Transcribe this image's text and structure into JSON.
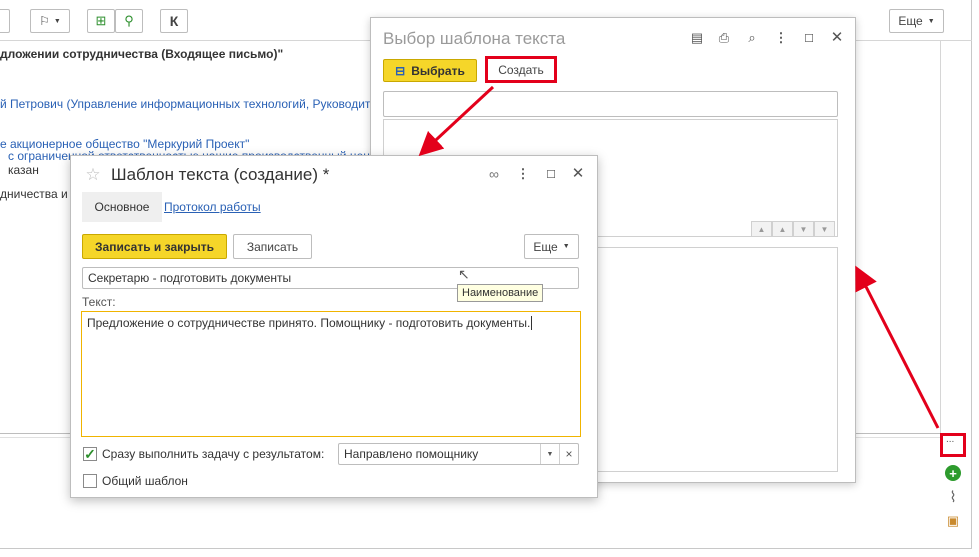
{
  "toolbar": {
    "more_label": "Еще",
    "k_label": "К"
  },
  "document": {
    "title_fragment": "дложении сотрудничества (Входящее письмо)\"",
    "author_fragment": "й Петрович (Управление информационных технологий, Руководите",
    "org_line1": "е акционерное общество \"Меркурий Проект\"",
    "org_line2": "с ограниченной ответственностью нашие производственный цент",
    "refused_fragment": "казан",
    "coop_fragment": "дничества и у"
  },
  "select_window": {
    "title": "Выбор шаблона текста",
    "select_label": "Выбрать",
    "create_label": "Создать"
  },
  "create_window": {
    "title": "Шаблон текста (создание) *",
    "tab_main": "Основное",
    "tab_log": "Протокол работы",
    "save_close_label": "Записать и закрыть",
    "save_label": "Записать",
    "more_label": "Еще",
    "name_value": "Секретарю - подготовить документы",
    "tooltip_text": "Наименование",
    "text_label": "Текст:",
    "text_value": "Предложение о сотрудничестве принято. Помощнику - подготовить документы.",
    "execute_label": "Сразу выполнить задачу с результатом:",
    "execute_checked": true,
    "result_value": "Направлено помощнику",
    "common_label": "Общий шаблон",
    "common_checked": false
  },
  "side": {
    "ellipsis_label": "..."
  },
  "colors": {
    "accent_yellow": "#f5d629",
    "link_blue": "#2a61b5",
    "annotation_red": "#e3001b",
    "focus_border": "#f0b400"
  }
}
